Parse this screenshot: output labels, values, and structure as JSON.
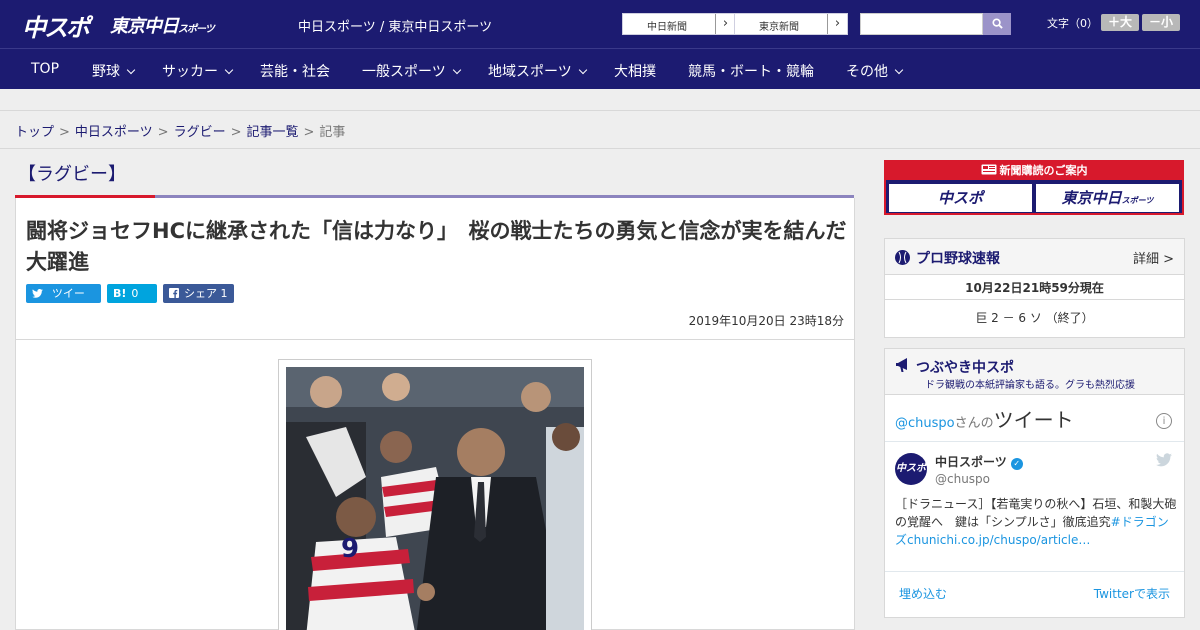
{
  "header": {
    "logo_chuspo": "中スポ",
    "logo_tokyo": "東京中日",
    "logo_tokyo_suffix": "スポーツ",
    "site_title": "中日スポーツ / 東京中日スポーツ",
    "paper_links": [
      {
        "label": "中日新聞",
        "arrow": "›"
      },
      {
        "label": "東京新聞",
        "arrow": "›"
      }
    ],
    "search": {
      "placeholder": "",
      "button_icon": "search-icon"
    },
    "font_size_label": "文字（0）",
    "font_plus": "＋大",
    "font_minus": "－小"
  },
  "nav": {
    "items": [
      {
        "label": "TOP",
        "has_dropdown": false
      },
      {
        "label": "野球",
        "has_dropdown": true
      },
      {
        "label": "サッカー",
        "has_dropdown": true
      },
      {
        "label": "芸能・社会",
        "has_dropdown": false
      },
      {
        "label": "一般スポーツ",
        "has_dropdown": true
      },
      {
        "label": "地域スポーツ",
        "has_dropdown": true
      },
      {
        "label": "大相撲",
        "has_dropdown": false
      },
      {
        "label": "競馬・ボート・競輪",
        "has_dropdown": false
      },
      {
        "label": "その他",
        "has_dropdown": true
      }
    ]
  },
  "breadcrumb": {
    "items": [
      "トップ",
      "中日スポーツ",
      "ラグビー",
      "記事一覧"
    ],
    "current": "記事",
    "separator": ">"
  },
  "article": {
    "category": "【ラグビー】",
    "title": "闘将ジョセフHCに継承された「信は力なり」　桜の戦士たちの勇気と信念が実を結んだ大躍進",
    "share": {
      "tweet_label": "ツイート",
      "hatena_icon": "B!",
      "hatena_count": "0",
      "facebook_label": "シェア",
      "facebook_count": "1"
    },
    "date": "2019年10月20日 23時18分"
  },
  "sidebar": {
    "subscribe": {
      "title": "新聞購読のご案内",
      "btn_chuspo": "中スポ",
      "btn_tokyo": "東京中日",
      "btn_tokyo_suffix": "スポーツ"
    },
    "baseball": {
      "title": "プロ野球速報",
      "detail_link": "詳細 >",
      "timestamp": "10月22日21時59分現在",
      "score": "巨 2 － 6 ソ （終了）"
    },
    "twitter": {
      "title": "つぶやき中スポ",
      "subtitle": "ドラ観戦の本紙評論家も語る。グラも熱烈応援",
      "heading_user": "@chuspo",
      "heading_san": "さんの",
      "heading_tweet": "ツイート",
      "account_name": "中日スポーツ",
      "account_handle": "@chuspo",
      "avatar_text": "中スポ",
      "tweet_text": "［ドラニュース］【若竜実りの秋へ】石垣、和製大砲の覚醒へ　鍵は「シンプルさ」徹底追究",
      "tweet_hashtag": "#ドラゴンズ",
      "tweet_link": "chunichi.co.jp/chuspo/article…",
      "embed_label": "埋め込む",
      "view_label": "Twitterで表示"
    }
  },
  "colors": {
    "brand_navy": "#1c1b71",
    "accent_red": "#d7192c",
    "twitter_blue": "#1b95e0",
    "hatena_blue": "#00a4de",
    "facebook_blue": "#3b5998"
  }
}
